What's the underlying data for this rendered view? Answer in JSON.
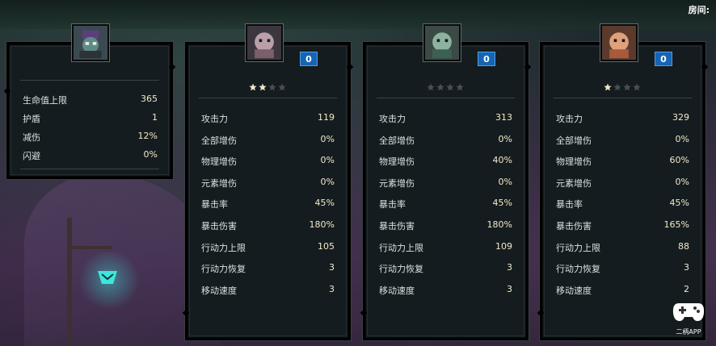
{
  "room": {
    "label": "房间:"
  },
  "player": {
    "stats": [
      {
        "label": "生命值上限",
        "value": "365"
      },
      {
        "label": "护盾",
        "value": "1"
      },
      {
        "label": "减伤",
        "value": "12%"
      },
      {
        "label": "闪避",
        "value": "0%"
      }
    ]
  },
  "units": [
    {
      "level": "0",
      "stars_filled": 2,
      "stars_total": 4,
      "stats": [
        {
          "label": "攻击力",
          "value": "119"
        },
        {
          "label": "全部增伤",
          "value": "0%"
        },
        {
          "label": "物理增伤",
          "value": "0%"
        },
        {
          "label": "元素增伤",
          "value": "0%"
        },
        {
          "label": "暴击率",
          "value": "45%"
        },
        {
          "label": "暴击伤害",
          "value": "180%"
        },
        {
          "label": "行动力上限",
          "value": "105"
        },
        {
          "label": "行动力恢复",
          "value": "3"
        },
        {
          "label": "移动速度",
          "value": "3"
        }
      ]
    },
    {
      "level": "0",
      "stars_filled": 0,
      "stars_total": 4,
      "stats": [
        {
          "label": "攻击力",
          "value": "313"
        },
        {
          "label": "全部增伤",
          "value": "0%"
        },
        {
          "label": "物理增伤",
          "value": "40%"
        },
        {
          "label": "元素增伤",
          "value": "0%"
        },
        {
          "label": "暴击率",
          "value": "45%"
        },
        {
          "label": "暴击伤害",
          "value": "180%"
        },
        {
          "label": "行动力上限",
          "value": "109"
        },
        {
          "label": "行动力恢复",
          "value": "3"
        },
        {
          "label": "移动速度",
          "value": "3"
        }
      ]
    },
    {
      "level": "0",
      "stars_filled": 1,
      "stars_total": 4,
      "stats": [
        {
          "label": "攻击力",
          "value": "329"
        },
        {
          "label": "全部增伤",
          "value": "0%"
        },
        {
          "label": "物理增伤",
          "value": "60%"
        },
        {
          "label": "元素增伤",
          "value": "0%"
        },
        {
          "label": "暴击率",
          "value": "45%"
        },
        {
          "label": "暴击伤害",
          "value": "165%"
        },
        {
          "label": "行动力上限",
          "value": "88"
        },
        {
          "label": "行动力恢复",
          "value": "3"
        },
        {
          "label": "移动速度",
          "value": "2"
        }
      ]
    }
  ],
  "watermark": {
    "label": "二柄APP",
    "icon": "gamepad-icon"
  },
  "colors": {
    "star_filled": "#f1e6c8",
    "star_empty": "#4a4f52",
    "badge": "#1565b4",
    "lamp_glow": "#3ee6dc"
  }
}
